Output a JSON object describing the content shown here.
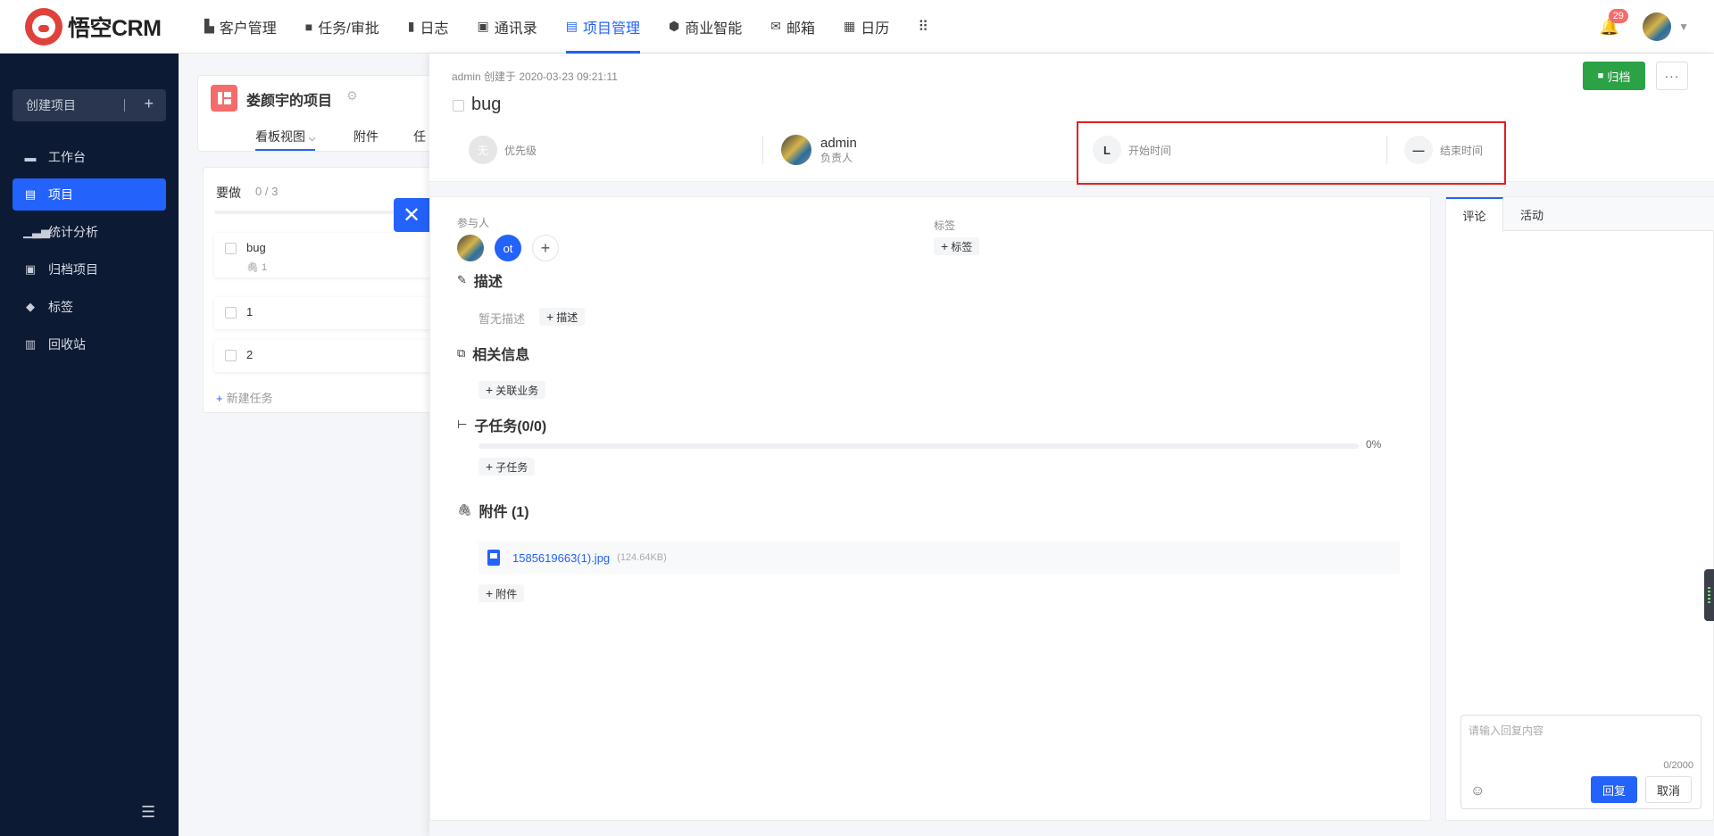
{
  "app": {
    "logo_text": "悟空CRM"
  },
  "nav": {
    "items": [
      {
        "label": "客户管理",
        "icon": "building-icon"
      },
      {
        "label": "任务/审批",
        "icon": "briefcase-icon"
      },
      {
        "label": "日志",
        "icon": "log-icon"
      },
      {
        "label": "通讯录",
        "icon": "contacts-icon"
      },
      {
        "label": "项目管理",
        "icon": "project-icon",
        "active": true
      },
      {
        "label": "商业智能",
        "icon": "bi-icon"
      },
      {
        "label": "邮箱",
        "icon": "mail-icon"
      },
      {
        "label": "日历",
        "icon": "calendar-icon"
      }
    ],
    "notifications": "29"
  },
  "sidebar": {
    "create_label": "创建项目",
    "items": [
      {
        "label": "工作台",
        "icon": "monitor-icon"
      },
      {
        "label": "项目",
        "icon": "board-icon",
        "active": true
      },
      {
        "label": "统计分析",
        "icon": "chart-icon"
      },
      {
        "label": "归档项目",
        "icon": "archive-icon"
      },
      {
        "label": "标签",
        "icon": "tag-icon"
      },
      {
        "label": "回收站",
        "icon": "trash-icon"
      }
    ]
  },
  "project": {
    "title": "娄颜宇的项目",
    "tabs": [
      "看板视图",
      "附件",
      "任"
    ],
    "column": {
      "title": "要做",
      "count": "0 / 3",
      "tasks": [
        {
          "name": "bug",
          "attachments": "1"
        },
        {
          "name": "1"
        },
        {
          "name": "2"
        }
      ],
      "new_task": "新建任务"
    }
  },
  "detail": {
    "creator": "admin 创建于 2020-03-23 09:21:11",
    "title": "bug",
    "archive_label": "归档",
    "more_label": "···",
    "priority": {
      "badge": "无",
      "label": "优先级"
    },
    "owner": {
      "name": "admin",
      "role": "负责人"
    },
    "start": {
      "badge": "L",
      "label": "开始时间"
    },
    "end": {
      "badge": "—",
      "label": "结束时间"
    },
    "participants_label": "参与人",
    "participant_initials": "ot",
    "tags_label": "标签",
    "add_tag": "标签",
    "description": {
      "title": "描述",
      "empty": "暂无描述",
      "add": "描述"
    },
    "related": {
      "title": "相关信息",
      "add": "关联业务"
    },
    "subtasks": {
      "title": "子任务(0/0)",
      "progress": "0%",
      "add": "子任务"
    },
    "attachments": {
      "title": "附件 (1)",
      "file_name": "1585619663(1).jpg",
      "file_size": "(124.64KB)",
      "add": "附件"
    }
  },
  "comments": {
    "tabs": [
      "评论",
      "活动"
    ],
    "placeholder": "请输入回复内容",
    "counter": "0/2000",
    "reply_label": "回复",
    "cancel_label": "取消"
  }
}
